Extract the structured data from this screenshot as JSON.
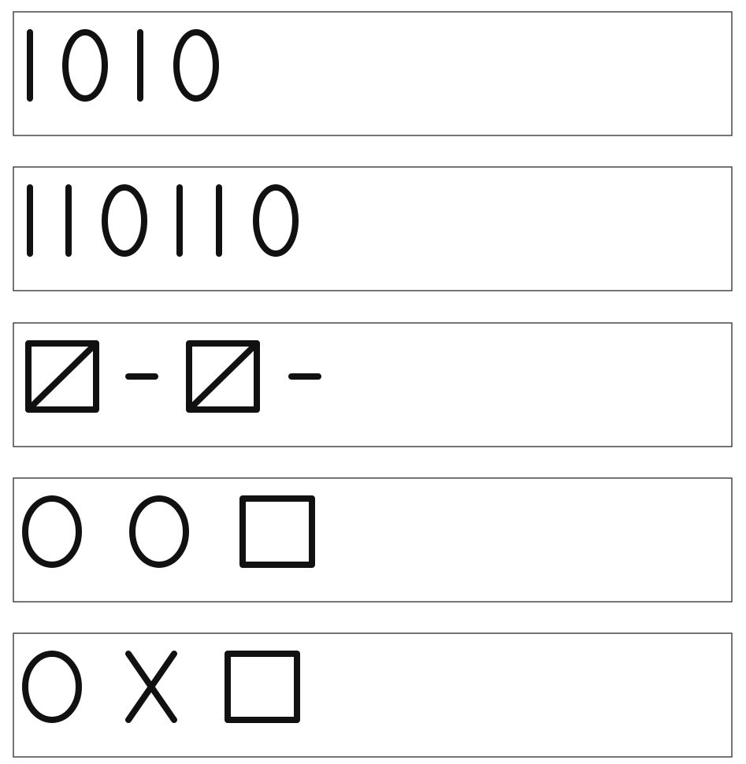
{
  "rows": [
    {
      "name": "row-1",
      "symbols": [
        "line",
        "oval",
        "line",
        "oval"
      ],
      "text": "1010"
    },
    {
      "name": "row-2",
      "symbols": [
        "line",
        "line",
        "oval",
        "line",
        "line",
        "oval"
      ],
      "text": "110110"
    },
    {
      "name": "row-3",
      "symbols": [
        "slashed-square",
        "dash",
        "slashed-square",
        "dash"
      ]
    },
    {
      "name": "row-4",
      "symbols": [
        "circle",
        "circle",
        "square"
      ]
    },
    {
      "name": "row-5",
      "symbols": [
        "circle",
        "cross",
        "square"
      ]
    }
  ],
  "colors": {
    "stroke": "#111111",
    "border": "#3a3a3a",
    "background": "#ffffff"
  }
}
